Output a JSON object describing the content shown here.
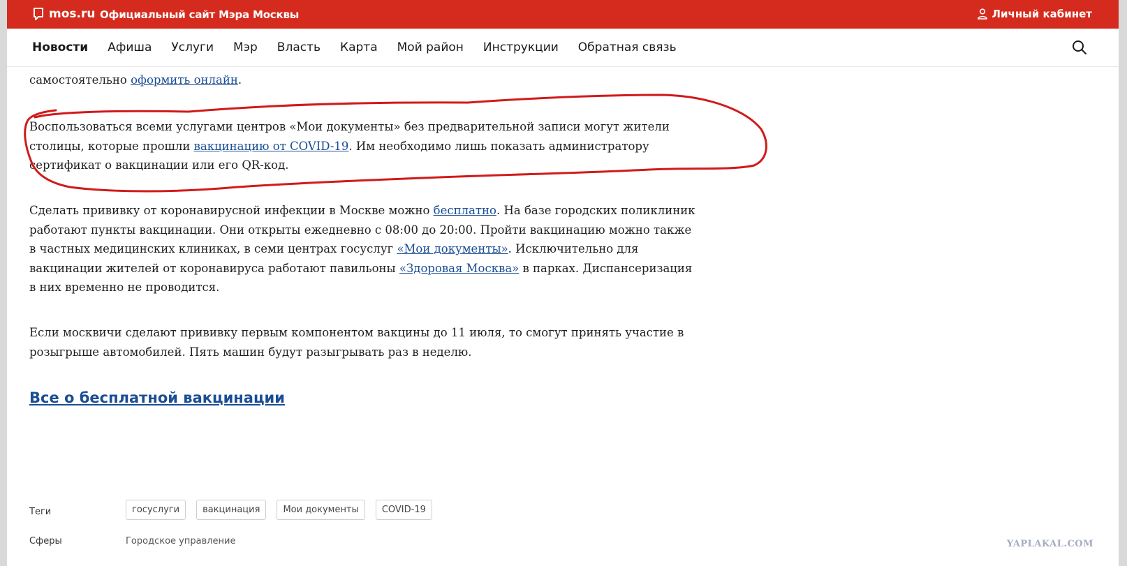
{
  "header": {
    "logo_text": "mos.ru",
    "site_title": "Официальный сайт Мэра Москвы",
    "cabinet_label": "Личный кабинет"
  },
  "nav": {
    "items": [
      {
        "label": "Новости",
        "active": true
      },
      {
        "label": "Афиша"
      },
      {
        "label": "Услуги"
      },
      {
        "label": "Мэр"
      },
      {
        "label": "Власть"
      },
      {
        "label": "Карта"
      },
      {
        "label": "Мой район"
      },
      {
        "label": "Инструкции"
      },
      {
        "label": "Обратная связь"
      }
    ]
  },
  "article": {
    "cut_text_before": "самостоятельно ",
    "cut_link": "оформить онлайн",
    "cut_text_after": ".",
    "p1_before": "Воспользоваться всеми услугами центров «Мои документы» без предварительной записи могут жители столицы, которые прошли ",
    "p1_link": "вакцинацию от COVID-19",
    "p1_after": ". Им необходимо лишь показать администратору сертификат о вакцинации или его QR-код.",
    "p2_a": "Сделать прививку от коронавирусной инфекции в Москве можно ",
    "p2_link1": "бесплатно",
    "p2_b": ". На базе городских поликлиник работают пункты вакцинации. Они открыты ежедневно с 08:00 до 20:00. Пройти вакцинацию можно также в частных медицинских клиниках, в семи центрах госуслуг ",
    "p2_link2": "«Мои документы»",
    "p2_c": ". Исключительно для вакцинации жителей от коронавируса работают павильоны ",
    "p2_link3": "«Здоровая Москва»",
    "p2_d": " в парках. Диспансеризация в них временно не проводится.",
    "p3": "Если москвичи сделают прививку первым компонентом вакцины до 11 июля, то смогут принять участие в розыгрыше автомобилей. Пять машин будут разыгрывать раз в неделю.",
    "all_link": "Все о бесплатной вакцинации"
  },
  "meta": {
    "tags_label": "Теги",
    "tags": [
      "госуслуги",
      "вакцинация",
      "Мои документы",
      "COVID-19"
    ],
    "spheres_label": "Сферы",
    "sphere_value": "Городское управление"
  },
  "watermark": "YAPLAKAL.COM",
  "colors": {
    "brand_red": "#d52b1e",
    "link_blue": "#1a4d94",
    "annotation_red": "#d11a1a"
  },
  "icons": {
    "logo": "mos-logo-icon",
    "cabinet": "user-icon",
    "search": "search-icon"
  }
}
